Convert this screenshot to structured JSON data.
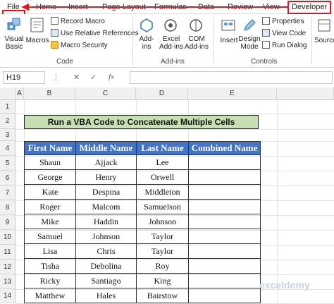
{
  "tabs": [
    "File",
    "Home",
    "Insert",
    "Page Layout",
    "Formulas",
    "Data",
    "Review",
    "View",
    "Developer"
  ],
  "ribbon": {
    "visual_basic": [
      "Visual",
      "Basic"
    ],
    "macros": "Macros",
    "record_macro": "Record Macro",
    "relative_refs": "Use Relative References",
    "macro_security": "Macro Security",
    "code_group": "Code",
    "addins": [
      "Add-",
      "ins"
    ],
    "excel_addins": [
      "Excel",
      "Add-ins"
    ],
    "com_addins": [
      "COM",
      "Add-ins"
    ],
    "addins_group": "Add-ins",
    "insert": "Insert",
    "design_mode": [
      "Design",
      "Mode"
    ],
    "properties": "Properties",
    "view_code": "View Code",
    "run_dialog": "Run Dialog",
    "controls_group": "Controls",
    "source": "Source"
  },
  "formula_bar": {
    "name_box": "H19",
    "fx": "fx",
    "cancel": "✕",
    "enter": "✓",
    "value": ""
  },
  "columns": [
    "A",
    "B",
    "C",
    "D",
    "E"
  ],
  "rows": [
    "1",
    "2",
    "3",
    "4",
    "5",
    "6",
    "7",
    "8",
    "9",
    "10",
    "11",
    "12",
    "13",
    "14"
  ],
  "sheet": {
    "title": "Run a VBA Code to Concatenate Multiple Cells",
    "headers": [
      "First Name",
      "Middle Name",
      "Last Name",
      "Combined Name"
    ],
    "data": [
      [
        "Shaun",
        "Ajjack",
        "Lee",
        ""
      ],
      [
        "George",
        "Henry",
        "Orwell",
        ""
      ],
      [
        "Kate",
        "Despina",
        "Middleton",
        ""
      ],
      [
        "Roger",
        "Malcom",
        "Samuelson",
        ""
      ],
      [
        "Mike",
        "Haddin",
        "Johnson",
        ""
      ],
      [
        "Samuel",
        "Johnson",
        "Taylor",
        ""
      ],
      [
        "Lisa",
        "Chris",
        "Taylor",
        ""
      ],
      [
        "Tisha",
        "Debolina",
        "Roy",
        ""
      ],
      [
        "Ricky",
        "Santiago",
        "King",
        ""
      ],
      [
        "Matthew",
        "Hales",
        "Bairstow",
        ""
      ]
    ]
  },
  "watermark": "exceldemy",
  "accent": "#e8141b",
  "header_fill": "#4472c4",
  "title_fill": "#c6e0b4"
}
